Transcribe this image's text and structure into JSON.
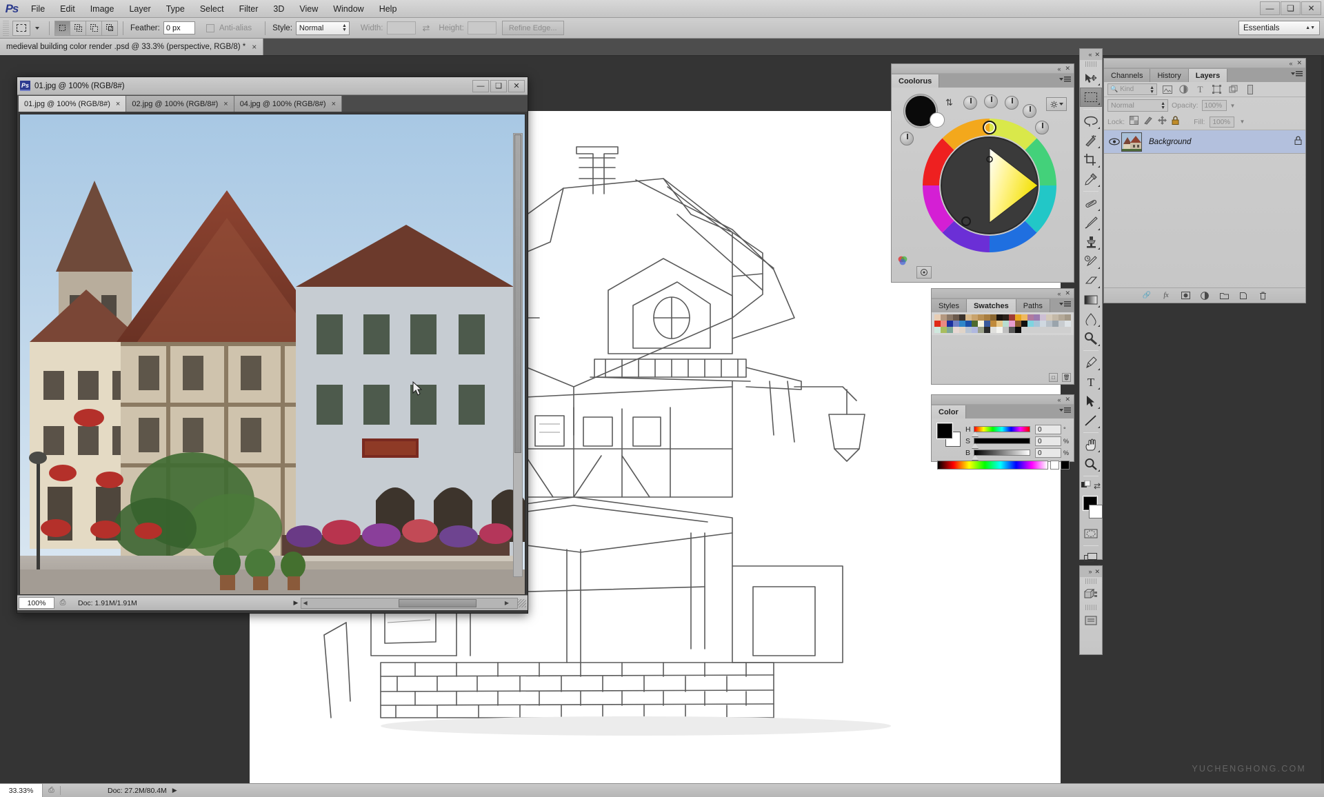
{
  "app": {
    "logo": "Ps",
    "workspace": "Essentials",
    "watermark": "YUCHENGHONG.COM"
  },
  "menubar": {
    "items": [
      "File",
      "Edit",
      "Image",
      "Layer",
      "Type",
      "Select",
      "Filter",
      "3D",
      "View",
      "Window",
      "Help"
    ],
    "window_controls": [
      {
        "name": "minimize",
        "glyph": "—"
      },
      {
        "name": "restore",
        "glyph": "❐"
      },
      {
        "name": "close",
        "glyph": "✕"
      }
    ]
  },
  "options_bar": {
    "tool_icon": "rectangular-marquee-icon",
    "selection_modes": [
      "new-selection",
      "add-to-selection",
      "subtract-from-selection",
      "intersect-selection"
    ],
    "active_selection_mode": 0,
    "feather_label": "Feather:",
    "feather_value": "0 px",
    "antialias_label": "Anti-alias",
    "antialias_checked": false,
    "style_label": "Style:",
    "style_value": "Normal",
    "width_label": "Width:",
    "width_value": "",
    "height_label": "Height:",
    "height_value": "",
    "refine_edge_label": "Refine Edge..."
  },
  "document_tabs": [
    {
      "title": "medieval building color render .psd @ 33.3% (perspective, RGB/8) *",
      "close": "×",
      "active": true
    }
  ],
  "float_window": {
    "title": "01.jpg @ 100% (RGB/8#)",
    "title_icon": "Ps",
    "controls": [
      {
        "name": "minimize",
        "glyph": "—"
      },
      {
        "name": "maximize",
        "glyph": "❐"
      },
      {
        "name": "close",
        "glyph": "✕"
      }
    ],
    "tabs": [
      {
        "label": "01.jpg @ 100% (RGB/8#)",
        "close": "×",
        "active": true
      },
      {
        "label": "02.jpg @ 100% (RGB/8#)",
        "close": "×",
        "active": false
      },
      {
        "label": "04.jpg @ 100% (RGB/8#)",
        "close": "×",
        "active": false
      }
    ],
    "status": {
      "zoom": "100%",
      "doc_info": "Doc: 1.91M/1.91M"
    }
  },
  "toolbar": {
    "tools": [
      {
        "name": "move-tool",
        "label": "Move Tool",
        "selected": false
      },
      {
        "name": "rectangular-marquee-tool",
        "label": "Rectangular Marquee Tool",
        "selected": true
      },
      {
        "name": "lasso-tool",
        "label": "Lasso Tool",
        "selected": false
      },
      {
        "name": "quick-selection-tool",
        "label": "Quick Selection Tool",
        "selected": false
      },
      {
        "name": "crop-tool",
        "label": "Crop Tool",
        "selected": false
      },
      {
        "name": "eyedropper-tool",
        "label": "Eyedropper Tool",
        "selected": false
      },
      {
        "name": "healing-brush-tool",
        "label": "Spot Healing Brush Tool",
        "selected": false
      },
      {
        "name": "brush-tool",
        "label": "Brush Tool",
        "selected": false
      },
      {
        "name": "clone-stamp-tool",
        "label": "Clone Stamp Tool",
        "selected": false
      },
      {
        "name": "history-brush-tool",
        "label": "History Brush Tool",
        "selected": false
      },
      {
        "name": "eraser-tool",
        "label": "Eraser Tool",
        "selected": false
      },
      {
        "name": "gradient-tool",
        "label": "Gradient Tool",
        "selected": false
      },
      {
        "name": "blur-tool",
        "label": "Blur Tool",
        "selected": false
      },
      {
        "name": "dodge-tool",
        "label": "Dodge Tool",
        "selected": false
      },
      {
        "name": "pen-tool",
        "label": "Pen Tool",
        "selected": false
      },
      {
        "name": "horizontal-type-tool",
        "label": "Horizontal Type Tool",
        "selected": false
      },
      {
        "name": "path-selection-tool",
        "label": "Path Selection Tool",
        "selected": false
      },
      {
        "name": "line-tool",
        "label": "Line Tool",
        "selected": false
      },
      {
        "name": "hand-tool",
        "label": "Hand Tool",
        "selected": false
      },
      {
        "name": "zoom-tool",
        "label": "Zoom Tool",
        "selected": false
      }
    ],
    "foreground_color": "#000000",
    "background_color": "#ffffff",
    "quick_mask_label": "Edit in Quick Mask Mode",
    "screen_mode_label": "Change Screen Mode"
  },
  "coolorus": {
    "tab_label": "Coolorus",
    "primary_color": "#0a0a0a",
    "secondary_color": "#ffffff",
    "selected_hue_deg": 58,
    "knobs": 6,
    "gear_label": "settings"
  },
  "swatches_panel": {
    "tabs": [
      {
        "label": "Styles",
        "active": false
      },
      {
        "label": "Swatches",
        "active": true
      },
      {
        "label": "Paths",
        "active": false
      }
    ],
    "colors": [
      "#e8cdb4",
      "#b49880",
      "#8b7868",
      "#6b5a4c",
      "#3a322c",
      "#d8b98b",
      "#c9a36c",
      "#b98f52",
      "#a87d3f",
      "#8a6630",
      "#1a1410",
      "#2b211a",
      "#9e3b35",
      "#e8a61e",
      "#f0b95e",
      "#b07aa0",
      "#9c7ab0",
      "#cdbfd4",
      "#d4c9b8",
      "#c4b9a8",
      "#b4a998",
      "#a49988",
      "#e02a18",
      "#e88a82",
      "#1a2f9e",
      "#6f7fc4",
      "#2f86c9",
      "#1b4fa8",
      "#4e6b2e",
      "#f7f4e0",
      "#3a5a9c",
      "#c08a3a",
      "#e8c98a",
      "#b8ddd0",
      "#e89ed0",
      "#8a5a2a",
      "#101010",
      "#7fd4e0",
      "#a8c4d8",
      "#cfd8e0",
      "#b8c0c8",
      "#9aa4ac",
      "#c8ccd0",
      "#dde2e6",
      "#cfe8dd",
      "#a8bd5e",
      "#7fa898",
      "#e8d8d4",
      "#e0d4c8",
      "#b8c4d4",
      "#b0b8e0",
      "#9aa08a",
      "#2a2a2a",
      "#e0e0dd",
      "#f4f4f0",
      "#c0c0c0",
      "#5a5a5a",
      "#0a0a0a",
      "#cfcfcf",
      "#cfcfcf",
      "#cfcfcf",
      "#cfcfcf",
      "#cfcfcf",
      "#cfcfcf",
      "#cfcfcf",
      "#cfcfcf"
    ]
  },
  "color_panel": {
    "tab_label": "Color",
    "foreground": "#000000",
    "background": "#ffffff",
    "mode": "HSB",
    "channels": [
      {
        "name": "H",
        "value": "0",
        "unit": "°"
      },
      {
        "name": "S",
        "value": "0",
        "unit": "%"
      },
      {
        "name": "B",
        "value": "0",
        "unit": "%"
      }
    ]
  },
  "layers_panel": {
    "tabs": [
      {
        "label": "Channels",
        "active": false
      },
      {
        "label": "History",
        "active": false
      },
      {
        "label": "Layers",
        "active": true
      }
    ],
    "filter_label": "Kind",
    "filter_icons": [
      "pixel-filter-icon",
      "adjustment-filter-icon",
      "type-filter-icon",
      "shape-filter-icon",
      "smart-object-filter-icon",
      "filter-toggle-icon"
    ],
    "blend_mode": "Normal",
    "opacity_label": "Opacity:",
    "opacity_value": "100%",
    "lock_label": "Lock:",
    "lock_icons": [
      "lock-transparent-pixels-icon",
      "lock-image-pixels-icon",
      "lock-position-icon",
      "lock-all-icon"
    ],
    "fill_label": "Fill:",
    "fill_value": "100%",
    "layers": [
      {
        "name": "Background",
        "visible": true,
        "locked": true,
        "selected": true
      }
    ],
    "footer_icons": [
      "link-layers-icon",
      "layer-style-icon",
      "layer-mask-icon",
      "new-fill-adjustment-icon",
      "new-group-icon",
      "new-layer-icon",
      "delete-layer-icon"
    ]
  },
  "status_bar": {
    "zoom": "33.33%",
    "doc_info": "Doc: 27.2M/80.4M",
    "arrow": "▶"
  }
}
